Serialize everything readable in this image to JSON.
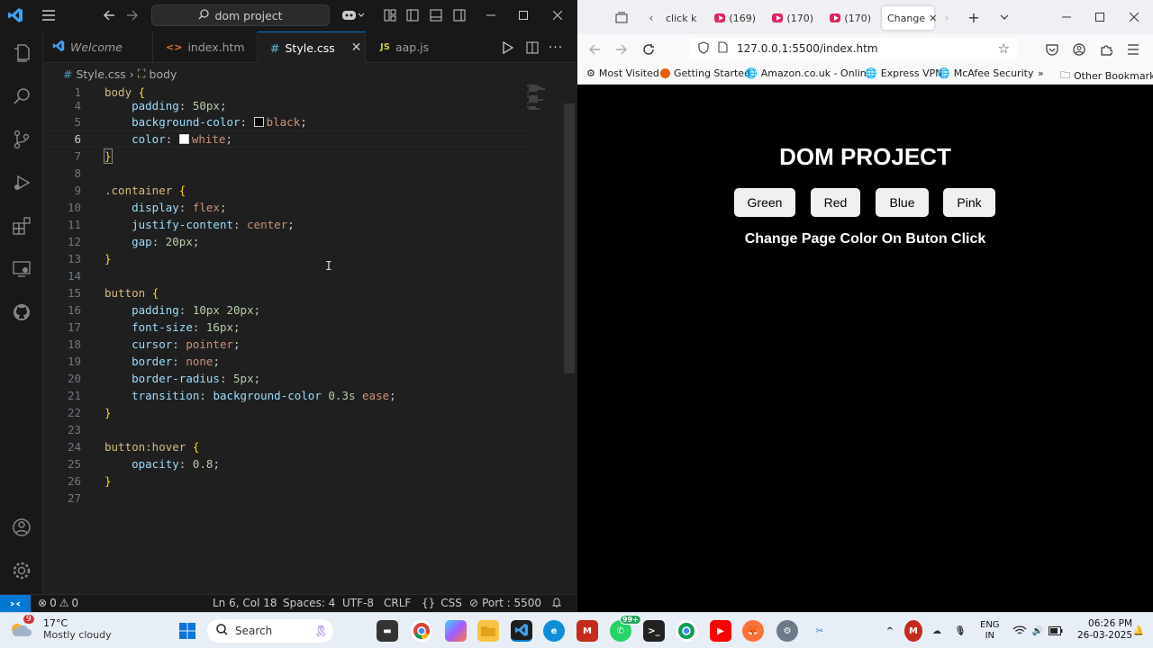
{
  "vscode": {
    "search_text": "dom project",
    "tabs": [
      {
        "label": "Welcome",
        "icon": "vscode-icon"
      },
      {
        "label": "index.htm",
        "icon": "html-icon"
      },
      {
        "label": "Style.css",
        "icon": "css-icon",
        "active": true
      },
      {
        "label": "aap.js",
        "icon": "js-icon",
        "prefix": "JS"
      }
    ],
    "breadcrumb": {
      "file": "Style.css",
      "symbol": "body"
    },
    "code_lines": [
      {
        "n": "1",
        "text": "body {"
      },
      {
        "n": "4",
        "text": "    padding: 50px;"
      },
      {
        "n": "5",
        "text": "    background-color: black;"
      },
      {
        "n": "6",
        "text": "    color: white;"
      },
      {
        "n": "7",
        "text": "}"
      },
      {
        "n": "8",
        "text": ""
      },
      {
        "n": "9",
        "text": ".container {"
      },
      {
        "n": "10",
        "text": "    display: flex;"
      },
      {
        "n": "11",
        "text": "    justify-content: center;"
      },
      {
        "n": "12",
        "text": "    gap: 20px;"
      },
      {
        "n": "13",
        "text": "}"
      },
      {
        "n": "14",
        "text": ""
      },
      {
        "n": "15",
        "text": "button {"
      },
      {
        "n": "16",
        "text": "    padding: 10px 20px;"
      },
      {
        "n": "17",
        "text": "    font-size: 16px;"
      },
      {
        "n": "18",
        "text": "    cursor: pointer;"
      },
      {
        "n": "19",
        "text": "    border: none;"
      },
      {
        "n": "20",
        "text": "    border-radius: 5px;"
      },
      {
        "n": "21",
        "text": "    transition: background-color 0.3s ease;"
      },
      {
        "n": "22",
        "text": "}"
      },
      {
        "n": "23",
        "text": ""
      },
      {
        "n": "24",
        "text": "button:hover {"
      },
      {
        "n": "25",
        "text": "    opacity: 0.8;"
      },
      {
        "n": "26",
        "text": "}"
      },
      {
        "n": "27",
        "text": ""
      }
    ],
    "status": {
      "errors": "0",
      "warnings": "0",
      "position": "Ln 6, Col 18",
      "spaces": "Spaces: 4",
      "encoding": "UTF-8",
      "eol": "CRLF",
      "language": "CSS",
      "port": "Port : 5500"
    },
    "colors": {
      "accent": "#0078d4",
      "background": "#1f1f1f"
    }
  },
  "firefox": {
    "tabs": [
      {
        "label": "click k"
      },
      {
        "label": "(169)"
      },
      {
        "label": "(170)"
      },
      {
        "label": "(170)"
      },
      {
        "label": "Change",
        "active": true
      }
    ],
    "url": "127.0.0.1:5500/index.htm",
    "bookmarks": [
      "Most Visited",
      "Getting Started",
      "Amazon.co.uk - Onlin...",
      "Express VPN",
      "McAfee Security"
    ],
    "other_bookmarks": "Other Bookmarks"
  },
  "page": {
    "title": "DOM PROJECT",
    "buttons": [
      "Green",
      "Red",
      "Blue",
      "Pink"
    ],
    "subtitle": "Change Page Color On Buton Click"
  },
  "taskbar": {
    "weather_temp": "17°C",
    "weather_desc": "Mostly cloudy",
    "weather_badge": "9",
    "search": "Search",
    "whatsapp_badge": "99+",
    "lang": "ENG",
    "region": "IN",
    "time": "06:26 PM",
    "date": "26-03-2025"
  }
}
